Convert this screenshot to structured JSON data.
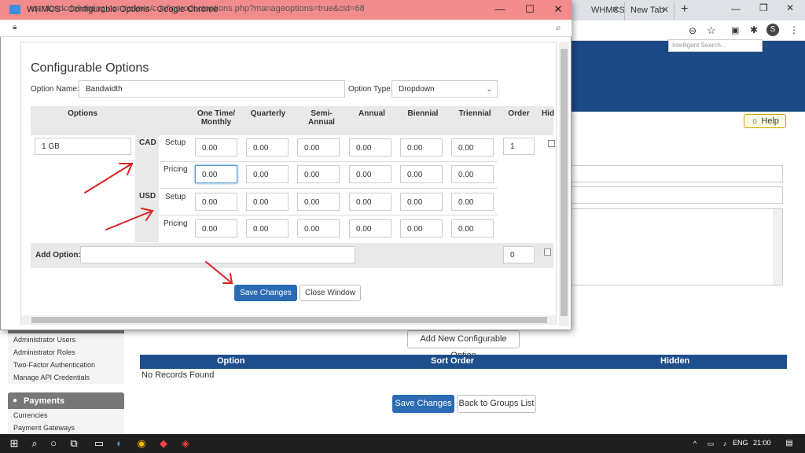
{
  "background": {
    "tabs": [
      {
        "label": "WHMCS"
      },
      {
        "label": "New Tab"
      }
    ],
    "search_placeholder": "Intelligent Search...",
    "help_label": "Help",
    "sidebar": {
      "links_group1": [
        "Administrator Users",
        "Administrator Roles",
        "Two-Factor Authentication",
        "Manage API Credentials"
      ],
      "payments_header": "Payments",
      "links_group2": [
        "Currencies",
        "Payment Gateways"
      ]
    },
    "add_new_button": "Add New Configurable Option",
    "table_headers": [
      "Option",
      "Sort Order",
      "Hidden"
    ],
    "no_records": "No Records Found",
    "save_button": "Save Changes",
    "back_button": "Back to Groups List",
    "taskbar": {
      "lang": "ENG",
      "time": "21:00"
    }
  },
  "popup": {
    "window_title": "WHMCS - Configurable Options - Google Chrome",
    "url": "cp.cloudcdnhosting.com/admin/configproductoptions.php?manageoptions=true&cid=68",
    "heading": "Configurable Options",
    "option_name_label": "Option Name:",
    "option_name_value": "Bandwidth",
    "option_type_label": "Option Type:",
    "option_type_value": "Dropdown",
    "columns": {
      "options": "Options",
      "onetime": "One Time/ Monthly",
      "quarterly": "Quarterly",
      "semi": "Semi- Annual",
      "annual": "Annual",
      "biennial": "Biennial",
      "triennial": "Triennial",
      "order": "Order",
      "hidden": "Hid"
    },
    "option_value": "1 GB",
    "order_value": "1",
    "currencies": [
      {
        "code": "CAD",
        "setup_label": "Setup",
        "pricing_label": "Pricing",
        "setup": [
          "0.00",
          "0.00",
          "0.00",
          "0.00",
          "0.00",
          "0.00"
        ],
        "pricing": [
          "0.00",
          "0.00",
          "0.00",
          "0.00",
          "0.00",
          "0.00"
        ]
      },
      {
        "code": "USD",
        "setup_label": "Setup",
        "pricing_label": "Pricing",
        "setup": [
          "0.00",
          "0.00",
          "0.00",
          "0.00",
          "0.00",
          "0.00"
        ],
        "pricing": [
          "0.00",
          "0.00",
          "0.00",
          "0.00",
          "0.00",
          "0.00"
        ]
      }
    ],
    "add_option_label": "Add Option:",
    "add_option_order": "0",
    "save_button": "Save Changes",
    "close_button": "Close Window"
  },
  "colors": {
    "arrow": "#e02020",
    "primary_button": "#2a6bb3",
    "header_blue": "#1f4e8c",
    "popup_titlebar": "#f28b8b"
  }
}
